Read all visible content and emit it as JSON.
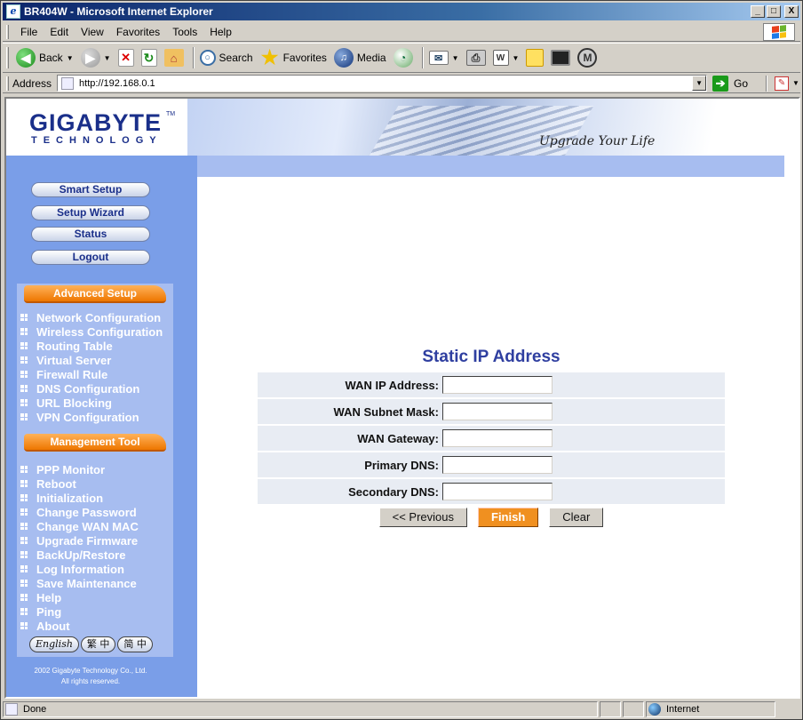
{
  "window": {
    "title": "BR404W - Microsoft Internet Explorer",
    "controls": {
      "minimize": "_",
      "maximize": "□",
      "close": "X"
    }
  },
  "menubar": {
    "items": [
      "File",
      "Edit",
      "View",
      "Favorites",
      "Tools",
      "Help"
    ]
  },
  "toolbar": {
    "back_label": "Back",
    "search_label": "Search",
    "favorites_label": "Favorites",
    "media_label": "Media"
  },
  "addressbar": {
    "label": "Address",
    "url": "http://192.168.0.1",
    "go_label": "Go"
  },
  "header": {
    "logo_text": "GIGABYTE",
    "logo_sub": "TECHNOLOGY",
    "logo_tm": "TM",
    "slogan": "Upgrade Your Life"
  },
  "sidebar": {
    "quick_buttons": [
      "Smart Setup",
      "Setup Wizard",
      "Status",
      "Logout"
    ],
    "advanced_title": "Advanced Setup",
    "advanced_items": [
      "Network Configuration",
      "Wireless Configuration",
      "Routing Table",
      "Virtual Server",
      "Firewall Rule",
      "DNS Configuration",
      "URL Blocking",
      "VPN Configuration"
    ],
    "management_title": "Management Tool",
    "management_items": [
      "PPP Monitor",
      "Reboot",
      "Initialization",
      "Change Password",
      "Change WAN MAC",
      "Upgrade Firmware",
      "BackUp/Restore",
      "Log Information",
      "Save Maintenance",
      "Help",
      "Ping",
      "About"
    ],
    "languages": [
      "English",
      "繁 中",
      "简 中"
    ],
    "copyright_line1": "2002 Gigabyte Technology Co., Ltd.",
    "copyright_line2": "All rights reserved."
  },
  "form": {
    "title": "Static IP Address",
    "fields": [
      {
        "label": "WAN IP Address:",
        "value": ""
      },
      {
        "label": "WAN Subnet Mask:",
        "value": ""
      },
      {
        "label": "WAN Gateway:",
        "value": ""
      },
      {
        "label": "Primary DNS:",
        "value": ""
      },
      {
        "label": "Secondary DNS:",
        "value": ""
      }
    ],
    "buttons": {
      "previous": "<< Previous",
      "finish": "Finish",
      "clear": "Clear"
    }
  },
  "statusbar": {
    "text": "Done",
    "zone": "Internet"
  },
  "colors": {
    "sidebar_bg": "#7a9ee8",
    "section_head": "#ee7600",
    "title_blue": "#2f3fa0",
    "finish_button": "#f09020"
  }
}
